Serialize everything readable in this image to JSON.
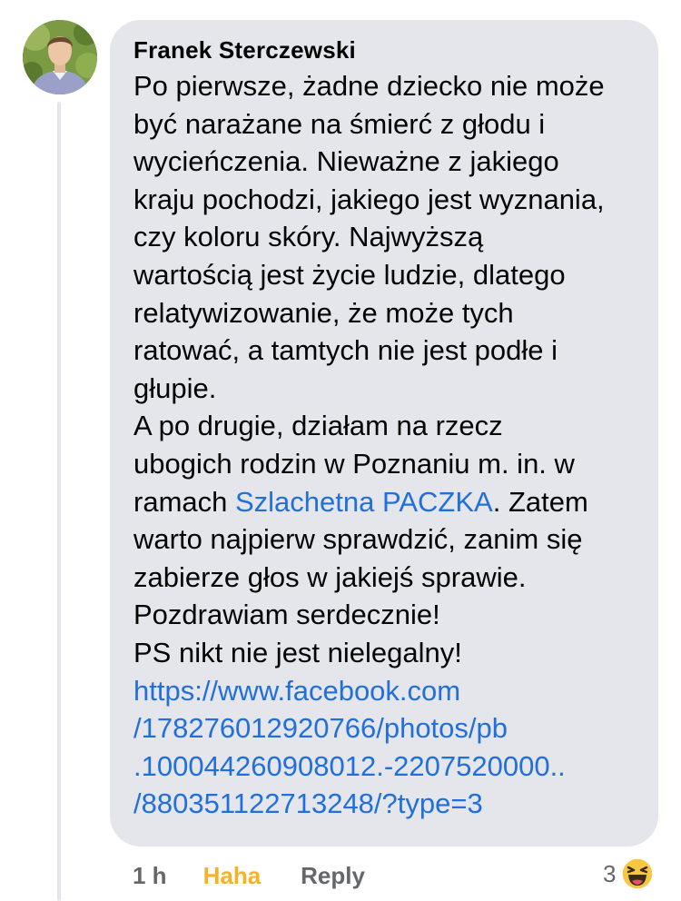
{
  "comment": {
    "author": "Franek Sterczewski",
    "lines": [
      {
        "pre": "Po pierwsze, żadne dziecko nie może"
      },
      {
        "pre": "być narażane na śmierć z głodu i"
      },
      {
        "pre": "wycieńczenia. Nieważne z jakiego"
      },
      {
        "pre": "kraju pochodzi, jakiego jest wyznania,"
      },
      {
        "pre": "czy koloru skóry. Najwyższą"
      },
      {
        "pre": "wartością jest życie ludzie, dlatego"
      },
      {
        "pre": "relatywizowanie, że może tych"
      },
      {
        "pre": "ratować, a tamtych nie jest podłe i"
      },
      {
        "pre": "głupie."
      },
      {
        "pre": "A po drugie, działam na rzecz"
      },
      {
        "pre": "ubogich rodzin w Poznaniu m. in. w"
      },
      {
        "pre": "ramach ",
        "link": "Szlachetna PACZKA",
        "post": ". Zatem"
      },
      {
        "pre": "warto najpierw sprawdzić, zanim się"
      },
      {
        "pre": "zabierze głos w jakiejś sprawie."
      },
      {
        "pre": "Pozdrawiam serdecznie!"
      },
      {
        "pre": "PS nikt nie jest nielegalny!"
      }
    ],
    "url_lines": [
      "https://www.facebook.com",
      "/178276012920766/photos/pb",
      ".100044260908012.-2207520000..",
      "/880351122713248/?type=3"
    ]
  },
  "meta": {
    "time": "1 h",
    "haha_label": "Haha",
    "reply_label": "Reply",
    "reaction_count": "3",
    "reaction_icon": "haha-emoji-icon"
  },
  "colors": {
    "bubble": "#e4e6eb",
    "link": "#216fdb",
    "haha": "#f7b125",
    "meta": "#65676b"
  }
}
